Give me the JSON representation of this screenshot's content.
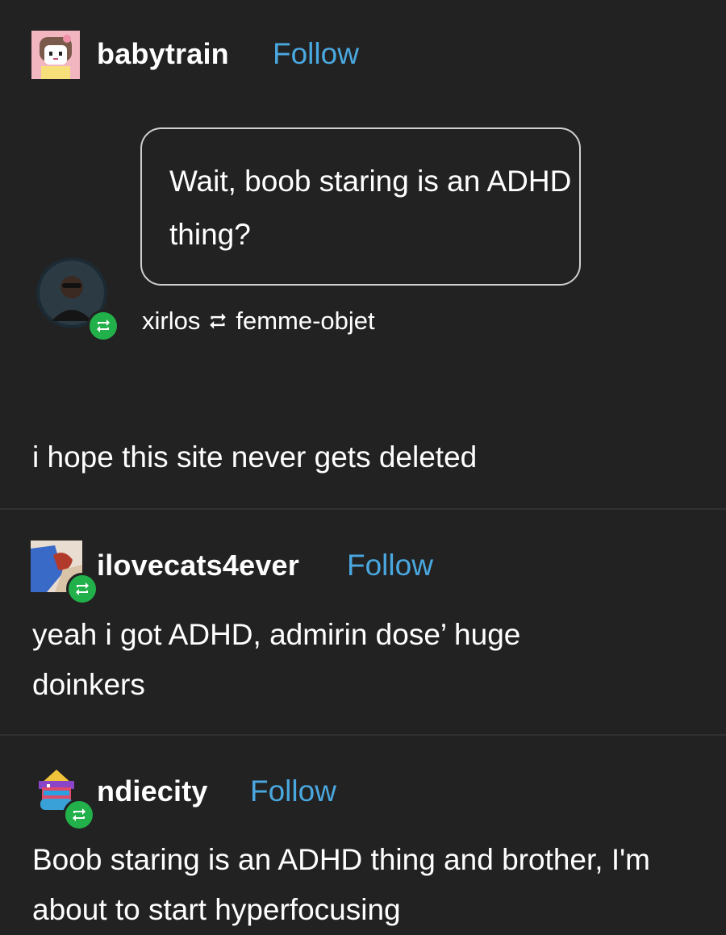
{
  "posts": [
    {
      "username": "babytrain",
      "follow_label": "Follow",
      "quote": "Wait, boob staring is an ADHD thing?",
      "reblog_from": "xirlos",
      "reblog_via": "femme-objet",
      "body": "i hope this site never gets deleted"
    },
    {
      "username": "ilovecats4ever",
      "follow_label": "Follow",
      "body": "yeah i got ADHD, admirin dose’ huge doinkers"
    },
    {
      "username": "ndiecity",
      "follow_label": "Follow",
      "body": "Boob staring is an ADHD thing and brother, I'm about to start hyperfocusing"
    }
  ],
  "colors": {
    "background": "#222222",
    "follow": "#4aa8e0",
    "reblog_badge": "#22b04a",
    "divider": "#303030"
  },
  "icons": {
    "reblog": "reblog-icon"
  }
}
